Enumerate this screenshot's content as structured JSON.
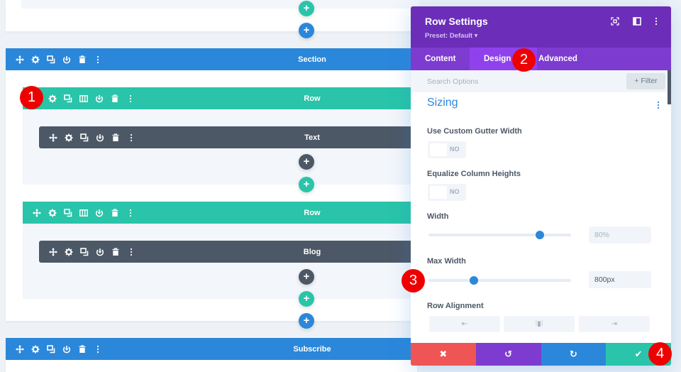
{
  "builder": {
    "sections": [
      {
        "label": "Section"
      },
      {
        "label": "Subscribe"
      }
    ],
    "rows": [
      {
        "label": "Row"
      },
      {
        "label": "Row"
      }
    ],
    "modules": [
      {
        "label": "Text"
      },
      {
        "label": "Blog"
      }
    ],
    "add_symbol": "+"
  },
  "markers": [
    "1",
    "2",
    "3",
    "4"
  ],
  "panel": {
    "title": "Row Settings",
    "preset": "Preset: Default ▾",
    "tabs": [
      {
        "label": "Content",
        "active": false
      },
      {
        "label": "Design",
        "active": true
      },
      {
        "label": "Advanced",
        "active": false
      }
    ],
    "search_placeholder": "Search Options",
    "filter_label": "+ Filter",
    "group_title": "Sizing",
    "options": {
      "gutter_label": "Use Custom Gutter Width",
      "gutter_value": "NO",
      "equalize_label": "Equalize Column Heights",
      "equalize_value": "NO",
      "width_label": "Width",
      "width_value": "80%",
      "width_slider_fraction": 0.78,
      "max_width_label": "Max Width",
      "max_width_value": "800px",
      "max_width_slider_fraction": 0.32,
      "alignment_label": "Row Alignment",
      "alignment_options": [
        "left",
        "center",
        "right"
      ]
    },
    "footer": {
      "cancel_icon": "✖",
      "undo_icon": "↺",
      "redo_icon": "↻",
      "save_icon": "✔"
    }
  },
  "colors": {
    "section": "#2b87da",
    "row": "#29c4a9",
    "module": "#4c5866",
    "panel_header": "#6c2eb9",
    "tabs": "#7e3bd0",
    "cancel": "#ef5555",
    "save": "#29c4a9",
    "marker": "#ee0000"
  }
}
